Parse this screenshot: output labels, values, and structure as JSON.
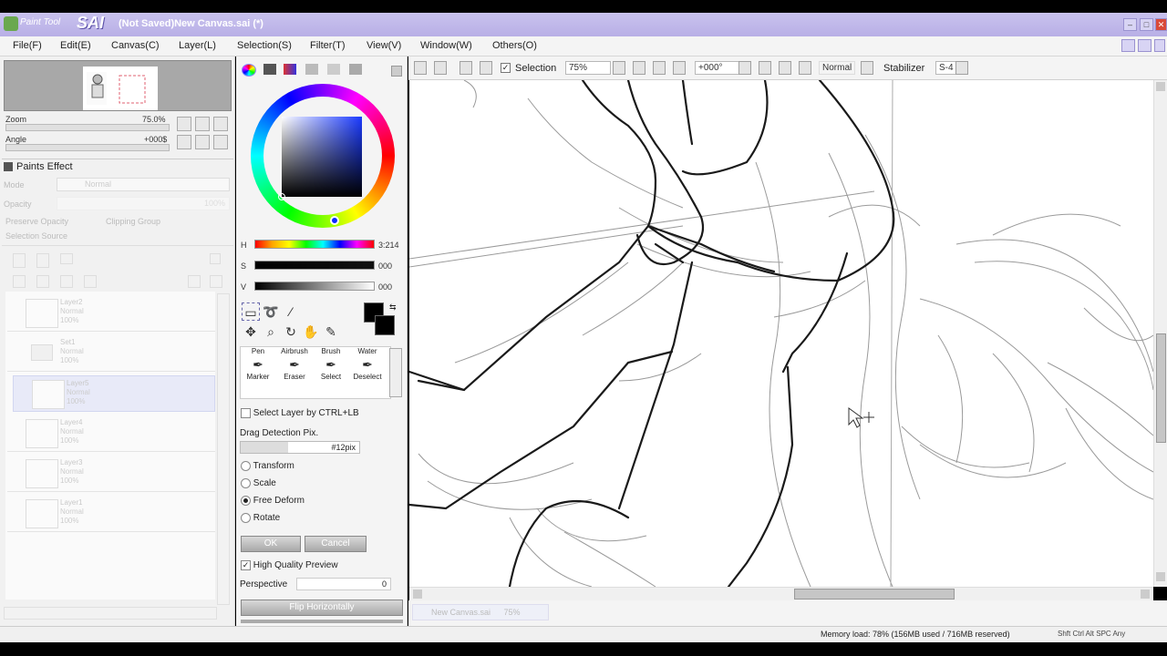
{
  "window": {
    "app_name": "Paint Tool",
    "sai_logo": "SAI",
    "document_title": "(Not Saved)New Canvas.sai (*)",
    "buttons": [
      "–",
      "□",
      "✕"
    ]
  },
  "menu": [
    {
      "label": "File(F)"
    },
    {
      "label": "Edit(E)"
    },
    {
      "label": "Canvas(C)"
    },
    {
      "label": "Layer(L)"
    },
    {
      "label": "Selection(S)"
    },
    {
      "label": "Filter(T)"
    },
    {
      "label": "View(V)"
    },
    {
      "label": "Window(W)"
    },
    {
      "label": "Others(O)"
    }
  ],
  "navigator": {
    "zoom_label": "Zoom",
    "zoom_value": "75.0%",
    "angle_label": "Angle",
    "angle_value": "+000$"
  },
  "layers_panel": {
    "paint_effect_title": "Paints Effect",
    "mode_label": "Mode",
    "mode_value": "Normal",
    "opacity_label": "Opacity",
    "opacity_value": "100%",
    "preserve_opacity": "Preserve Opacity",
    "clipping_group": "Clipping Group",
    "selection_source": "Selection Source",
    "layers": [
      {
        "name": "Layer2",
        "mode": "Normal",
        "opacity": "100%"
      },
      {
        "name": "Set1",
        "mode": "Normal",
        "opacity": "100%"
      },
      {
        "name": "Layer5",
        "mode": "Normal",
        "opacity": "100%"
      },
      {
        "name": "Layer4",
        "mode": "Normal",
        "opacity": "100%"
      },
      {
        "name": "Layer3",
        "mode": "Normal",
        "opacity": "100%"
      },
      {
        "name": "Layer1",
        "mode": "Normal",
        "opacity": "100%"
      }
    ]
  },
  "color": {
    "h_label": "H",
    "h_value": "3:214",
    "s_label": "S",
    "s_value": "000",
    "v_label": "V",
    "v_value": "000",
    "primary": "#000000",
    "secondary": "#000000"
  },
  "brushes": [
    {
      "label": "Pen"
    },
    {
      "label": "Airbrush"
    },
    {
      "label": "Brush"
    },
    {
      "label": "Water"
    },
    {
      "label": "Marker"
    },
    {
      "label": "Eraser"
    },
    {
      "label": "Select"
    },
    {
      "label": "Deselect"
    }
  ],
  "transform": {
    "select_layer_label": "Select Layer by CTRL+LB",
    "drag_detection_label": "Drag Detection Pix.",
    "drag_detection_value": "#12pix",
    "options": [
      "Transform",
      "Scale",
      "Free Deform",
      "Rotate"
    ],
    "selected_option": "Free Deform",
    "ok_label": "OK",
    "cancel_label": "Cancel",
    "high_quality_label": "High Quality Preview",
    "perspective_label": "Perspective",
    "perspective_value": "0",
    "flip_label": "Flip Horizontally"
  },
  "canvas_toolbar": {
    "selection_label": "Selection",
    "zoom_value": "75%",
    "angle_value": "+000°",
    "blend_mode": "Normal",
    "stabilizer_label": "Stabilizer",
    "stabilizer_value": "S-4"
  },
  "canvas_tab": {
    "name": "New Canvas.sai",
    "zoom": "75%"
  },
  "status": {
    "memory": "Memory load: 78% (156MB used / 716MB reserved)",
    "keys": "Shft Ctrl Alt SPC Any"
  }
}
